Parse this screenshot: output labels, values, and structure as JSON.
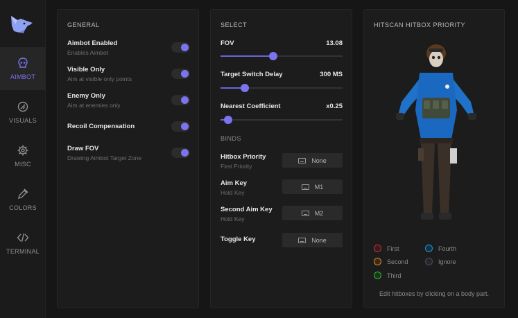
{
  "sidebar": {
    "items": [
      {
        "label": "AIMBOT",
        "icon": "skull-icon",
        "active": true
      },
      {
        "label": "VISUALS",
        "icon": "eye-icon",
        "active": false
      },
      {
        "label": "MISC",
        "icon": "gear-icon",
        "active": false
      },
      {
        "label": "COLORS",
        "icon": "eyedropper-icon",
        "active": false
      },
      {
        "label": "TERMINAL",
        "icon": "code-icon",
        "active": false
      }
    ]
  },
  "general": {
    "title": "GENERAL",
    "settings": [
      {
        "label": "Aimbot Enabled",
        "desc": "Enables Aimbot",
        "on": true
      },
      {
        "label": "Visible Only",
        "desc": "Aim at visible only points",
        "on": true
      },
      {
        "label": "Enemy Only",
        "desc": "Aim at enemies only",
        "on": true
      },
      {
        "label": "Recoil Compensation",
        "desc": "",
        "on": true
      },
      {
        "label": "Draw FOV",
        "desc": "Drawing Aimbot Target Zone",
        "on": true
      }
    ]
  },
  "select": {
    "title": "SELECT",
    "sliders": [
      {
        "label": "FOV",
        "value": "13.08",
        "fraction": 0.43
      },
      {
        "label": "Target Switch Delay",
        "value": "300 MS",
        "fraction": 0.2
      },
      {
        "label": "Nearest Coefficient",
        "value": "x0.25",
        "fraction": 0.06
      }
    ],
    "binds_title": "BINDS",
    "binds": [
      {
        "label": "Hitbox Priority",
        "desc": "First Priority",
        "value": "None"
      },
      {
        "label": "Aim Key",
        "desc": "Hold Key",
        "value": "M1"
      },
      {
        "label": "Second Aim Key",
        "desc": "Hold Key",
        "value": "M2"
      },
      {
        "label": "Toggle Key",
        "desc": "",
        "value": "None"
      }
    ]
  },
  "hitscan": {
    "title": "HITSCAN HITBOX PRIORITY",
    "legend": [
      {
        "label": "First",
        "color": "#c0302f"
      },
      {
        "label": "Fourth",
        "color": "#2b8fd6"
      },
      {
        "label": "Second",
        "color": "#d9892e"
      },
      {
        "label": "Ignore",
        "color": "#4a4f57"
      },
      {
        "label": "Third",
        "color": "#3fae3a"
      }
    ],
    "hint": "Edit hitboxes by clicking on a body part."
  },
  "colors": {
    "accent": "#7b74f0"
  }
}
